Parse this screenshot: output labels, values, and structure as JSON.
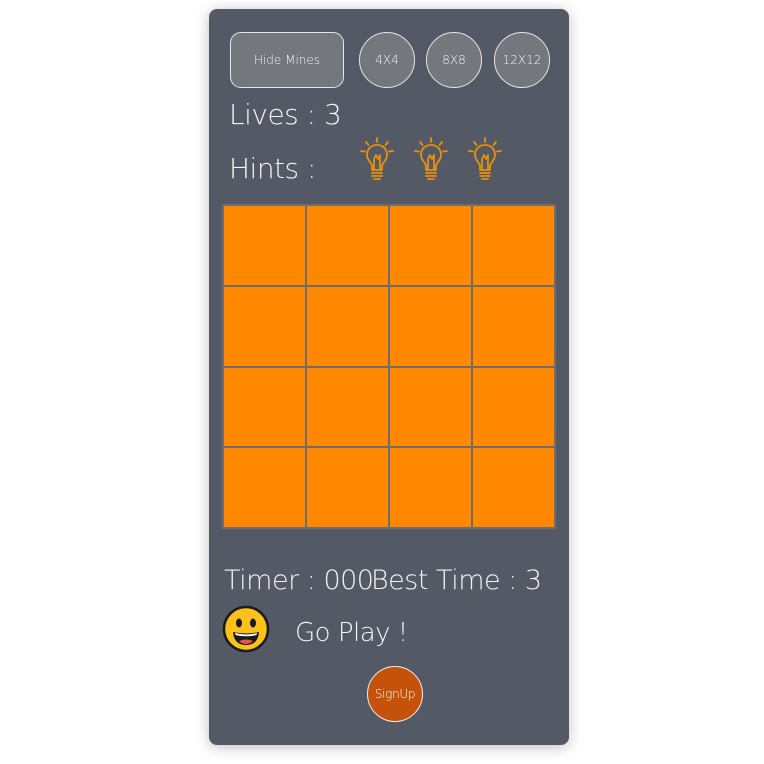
{
  "controls": {
    "hide_mines_label": "Hide Mines",
    "size_4_label": "4X4",
    "size_8_label": "8X8",
    "size_12_label": "12X12"
  },
  "stats": {
    "lives_text": "Lives : 3",
    "hints_text": "Hints :",
    "hints_available": 3,
    "hint_icon": "lightbulb-icon",
    "timer_text": "Timer : 000",
    "best_time_text": "Best Time : 3"
  },
  "board": {
    "rows": 4,
    "cols": 4,
    "cell_color": "#ff8800"
  },
  "status": {
    "face_icon": "smiley-face-icon",
    "message": "Go Play !"
  },
  "footer": {
    "signup_label": "SignUp"
  },
  "colors": {
    "panel_bg": "#535965",
    "button_bg": "#74777c",
    "hint_bulb": "#e8900c",
    "signup_bg": "#c4520a",
    "cell": "#ff8800"
  }
}
